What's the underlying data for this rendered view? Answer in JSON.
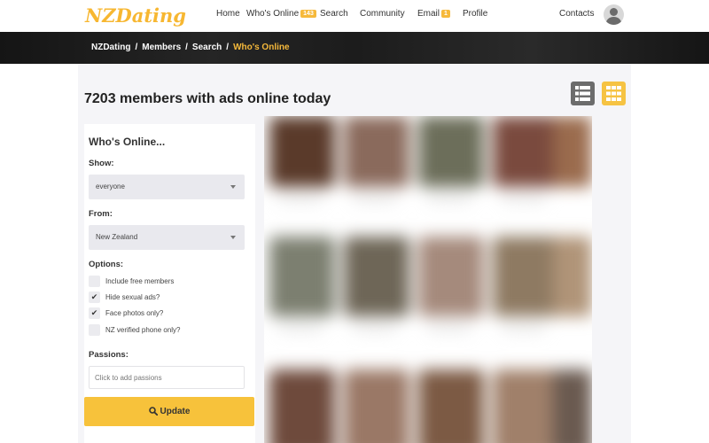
{
  "nav": {
    "logo": "NZDating",
    "home": "Home",
    "whos_online": "Who's Online",
    "whos_online_badge": "143",
    "search": "Search",
    "community": "Community",
    "email": "Email",
    "email_badge": "1",
    "profile": "Profile",
    "contacts": "Contacts"
  },
  "breadcrumb": {
    "items": [
      "NZDating",
      "Members",
      "Search"
    ],
    "current": "Who's Online"
  },
  "page_title": "7203 members with ads online today",
  "view_toggle": {
    "list_icon": "list-view-icon",
    "grid_icon": "grid-view-icon",
    "active": "grid"
  },
  "filter": {
    "title": "Who's Online...",
    "show_label": "Show:",
    "show_value": "everyone",
    "from_label": "From:",
    "from_value": "New Zealand",
    "options_label": "Options:",
    "options": [
      {
        "label": "Include free members",
        "checked": false
      },
      {
        "label": "Hide sexual ads?",
        "checked": true
      },
      {
        "label": "Face photos only?",
        "checked": true
      },
      {
        "label": "NZ verified phone only?",
        "checked": false
      }
    ],
    "passions_label": "Passions:",
    "passions_placeholder": "Click to add passions",
    "update_label": "Update"
  },
  "colors": {
    "accent": "#f6b93b",
    "button": "#f7c23b",
    "dark_band": "#1c1c1c",
    "active_crumb": "#f6b93b"
  }
}
